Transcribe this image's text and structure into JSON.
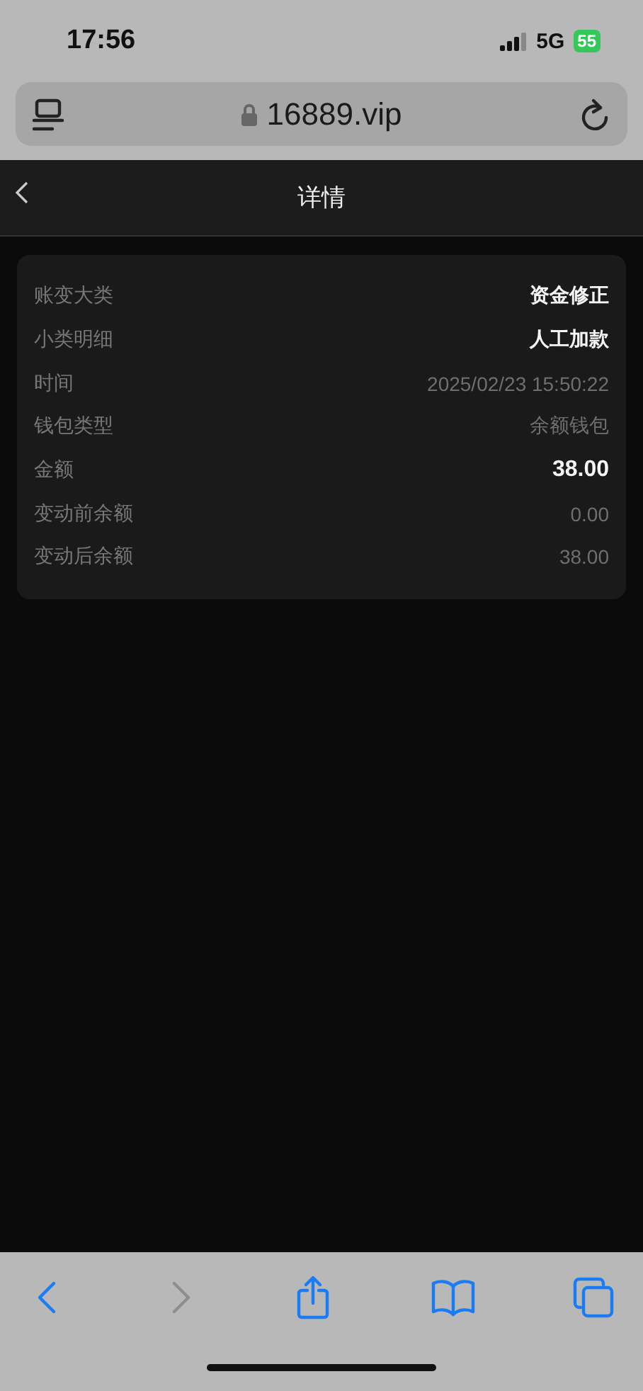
{
  "status_bar": {
    "time": "17:56",
    "network": "5G",
    "battery": "55"
  },
  "address_bar": {
    "url": "16889.vip"
  },
  "nav": {
    "title": "详情"
  },
  "details": [
    {
      "label": "账变大类",
      "value": "资金修正",
      "kind": "highlight"
    },
    {
      "label": "小类明细",
      "value": "人工加款",
      "kind": "highlight"
    },
    {
      "label": "时间",
      "value": "2025/02/23 15:50:22",
      "kind": "plain"
    },
    {
      "label": "钱包类型",
      "value": "余额钱包",
      "kind": "plain"
    },
    {
      "label": "金额",
      "value": "38.00",
      "kind": "amount"
    },
    {
      "label": "变动前余额",
      "value": "0.00",
      "kind": "plain"
    },
    {
      "label": "变动后余额",
      "value": "38.00",
      "kind": "plain"
    }
  ],
  "toolbar": {
    "back_disabled": false,
    "forward_disabled": true
  }
}
